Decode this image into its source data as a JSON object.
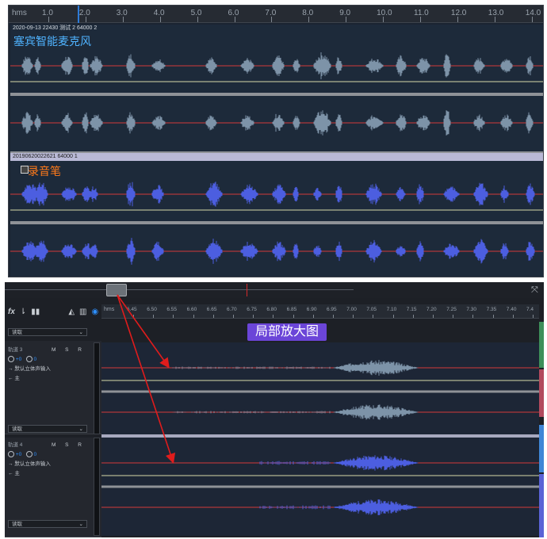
{
  "top_timeline": {
    "unit": "hms",
    "ticks": [
      "1.0",
      "2.0",
      "3.0",
      "4.0",
      "5.0",
      "6.0",
      "7.0",
      "8.0",
      "9.0",
      "10.0",
      "11.0",
      "12.0",
      "13.0",
      "14.0"
    ]
  },
  "clips": [
    {
      "header": "2020-09-13 22430 测试 2 64000 2",
      "name": "塞宾智能麦克风",
      "name_color": "#4fb3ff",
      "wave_color": "#7d93a8"
    },
    {
      "header": "20190620022621 64000 1",
      "name": "录音笔",
      "name_color": "#ff7a1a",
      "wave_color": "#4c5ee0"
    }
  ],
  "bottom_timeline": {
    "unit": "hms",
    "ticks": [
      "6.45",
      "6.50",
      "6.55",
      "6.60",
      "6.65",
      "6.70",
      "6.75",
      "6.80",
      "6.85",
      "6.90",
      "6.95",
      "7.00",
      "7.05",
      "7.10",
      "7.15",
      "7.20",
      "7.25",
      "7.30",
      "7.35",
      "7.40",
      "7.4"
    ]
  },
  "annotation": {
    "label": "局部放大图",
    "color": "#6b45d8"
  },
  "toolbar": {
    "fx": "fx"
  },
  "read_mode": "读取",
  "tracks": [
    {
      "name": "轨道 3",
      "msr": "M S R",
      "volume": "+0",
      "pan": "0",
      "input": "默认立体声输入",
      "output": "主"
    },
    {
      "name": "轨道 4",
      "msr": "M S R",
      "volume": "+0",
      "pan": "0",
      "input": "默认立体声输入",
      "output": "主"
    }
  ],
  "colors": {
    "center_line": "#d23a3a",
    "lane_divider": "#d8d9a8",
    "accent": "#2d8fff"
  }
}
